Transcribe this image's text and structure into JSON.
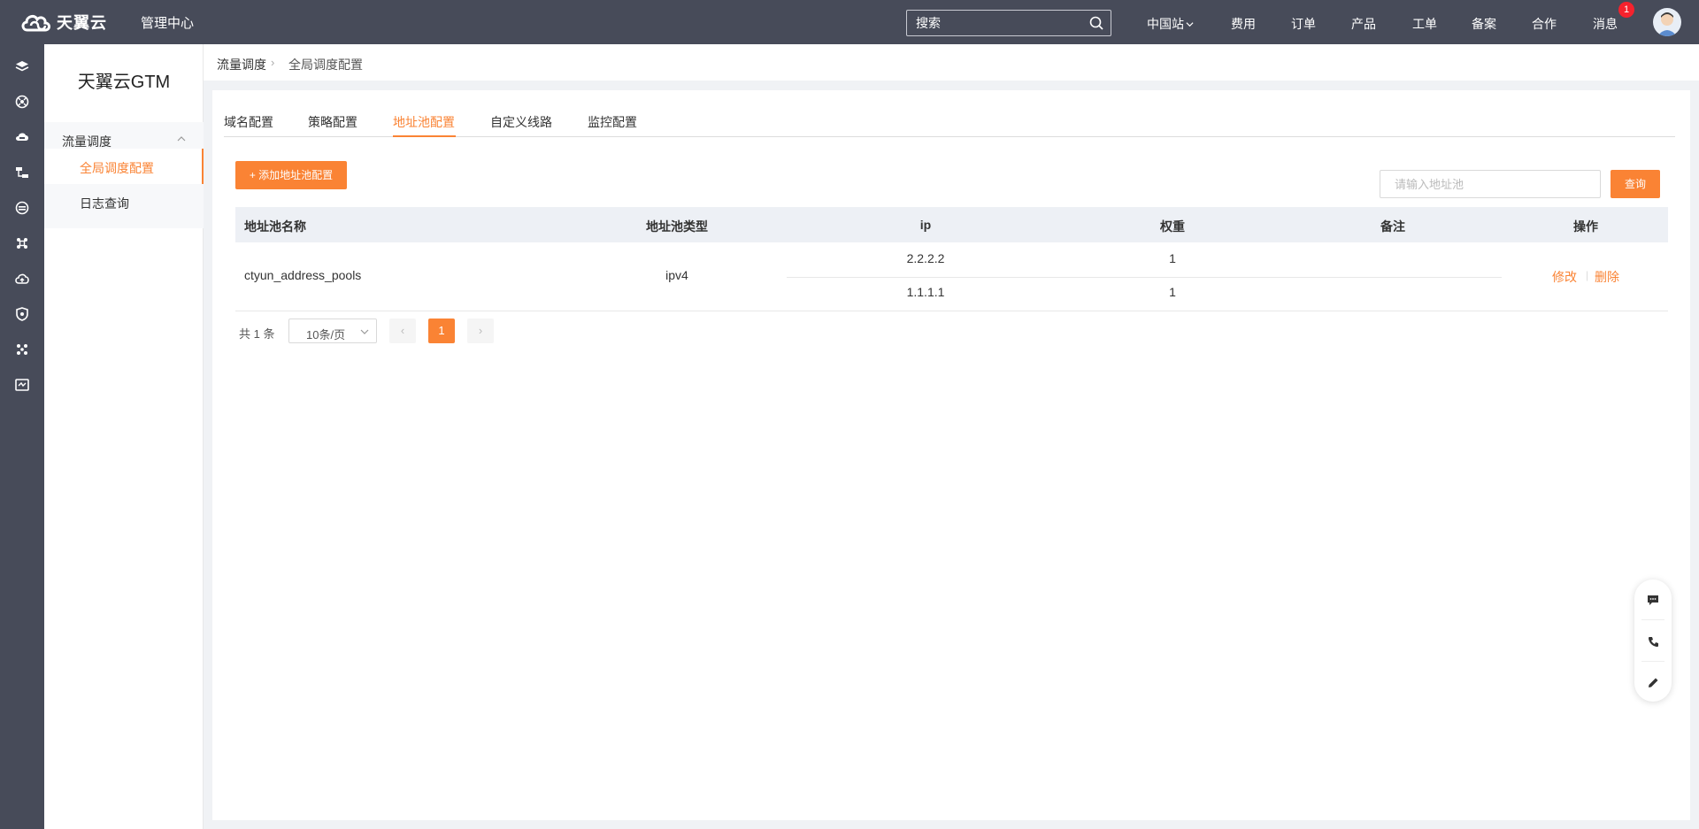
{
  "brand": {
    "name": "天翼云",
    "center": "管理中心",
    "accent": "#fa8334",
    "topbar_bg": "#474b59"
  },
  "top_search": {
    "placeholder": "搜索"
  },
  "top_nav": {
    "region": "中国站",
    "items": [
      "费用",
      "订单",
      "产品",
      "工单",
      "备案",
      "合作",
      "消息"
    ],
    "message_badge": "1"
  },
  "rail_icons": [
    "layers-icon",
    "dashboard-icon",
    "cloud-server-icon",
    "network-icon",
    "database-icon",
    "cluster-icon",
    "cloud-upload-icon",
    "shield-icon",
    "nodes-icon",
    "monitor-icon"
  ],
  "sidebar": {
    "title": "天翼云GTM",
    "group": "流量调度",
    "items": [
      "全局调度配置",
      "日志查询"
    ]
  },
  "breadcrumb": {
    "parent": "流量调度",
    "current": "全局调度配置"
  },
  "tabs": [
    "域名配置",
    "策略配置",
    "地址池配置",
    "自定义线路",
    "监控配置"
  ],
  "toolbar": {
    "add_label": "+ 添加地址池配置",
    "search_placeholder": "请输入地址池",
    "query_label": "查询"
  },
  "table": {
    "headers": [
      "地址池名称",
      "地址池类型",
      "ip",
      "权重",
      "备注",
      "操作"
    ],
    "rows": [
      {
        "name": "ctyun_address_pools",
        "type": "ipv4",
        "entries": [
          {
            "ip": "2.2.2.2",
            "weight": "1"
          },
          {
            "ip": "1.1.1.1",
            "weight": "1"
          }
        ],
        "remark": "",
        "actions": [
          "修改",
          "删除"
        ],
        "action_sep": "|"
      }
    ]
  },
  "pager": {
    "total": "共 1 条",
    "page_size": "10条/页",
    "current": "1",
    "prev": "‹",
    "next": "›"
  }
}
